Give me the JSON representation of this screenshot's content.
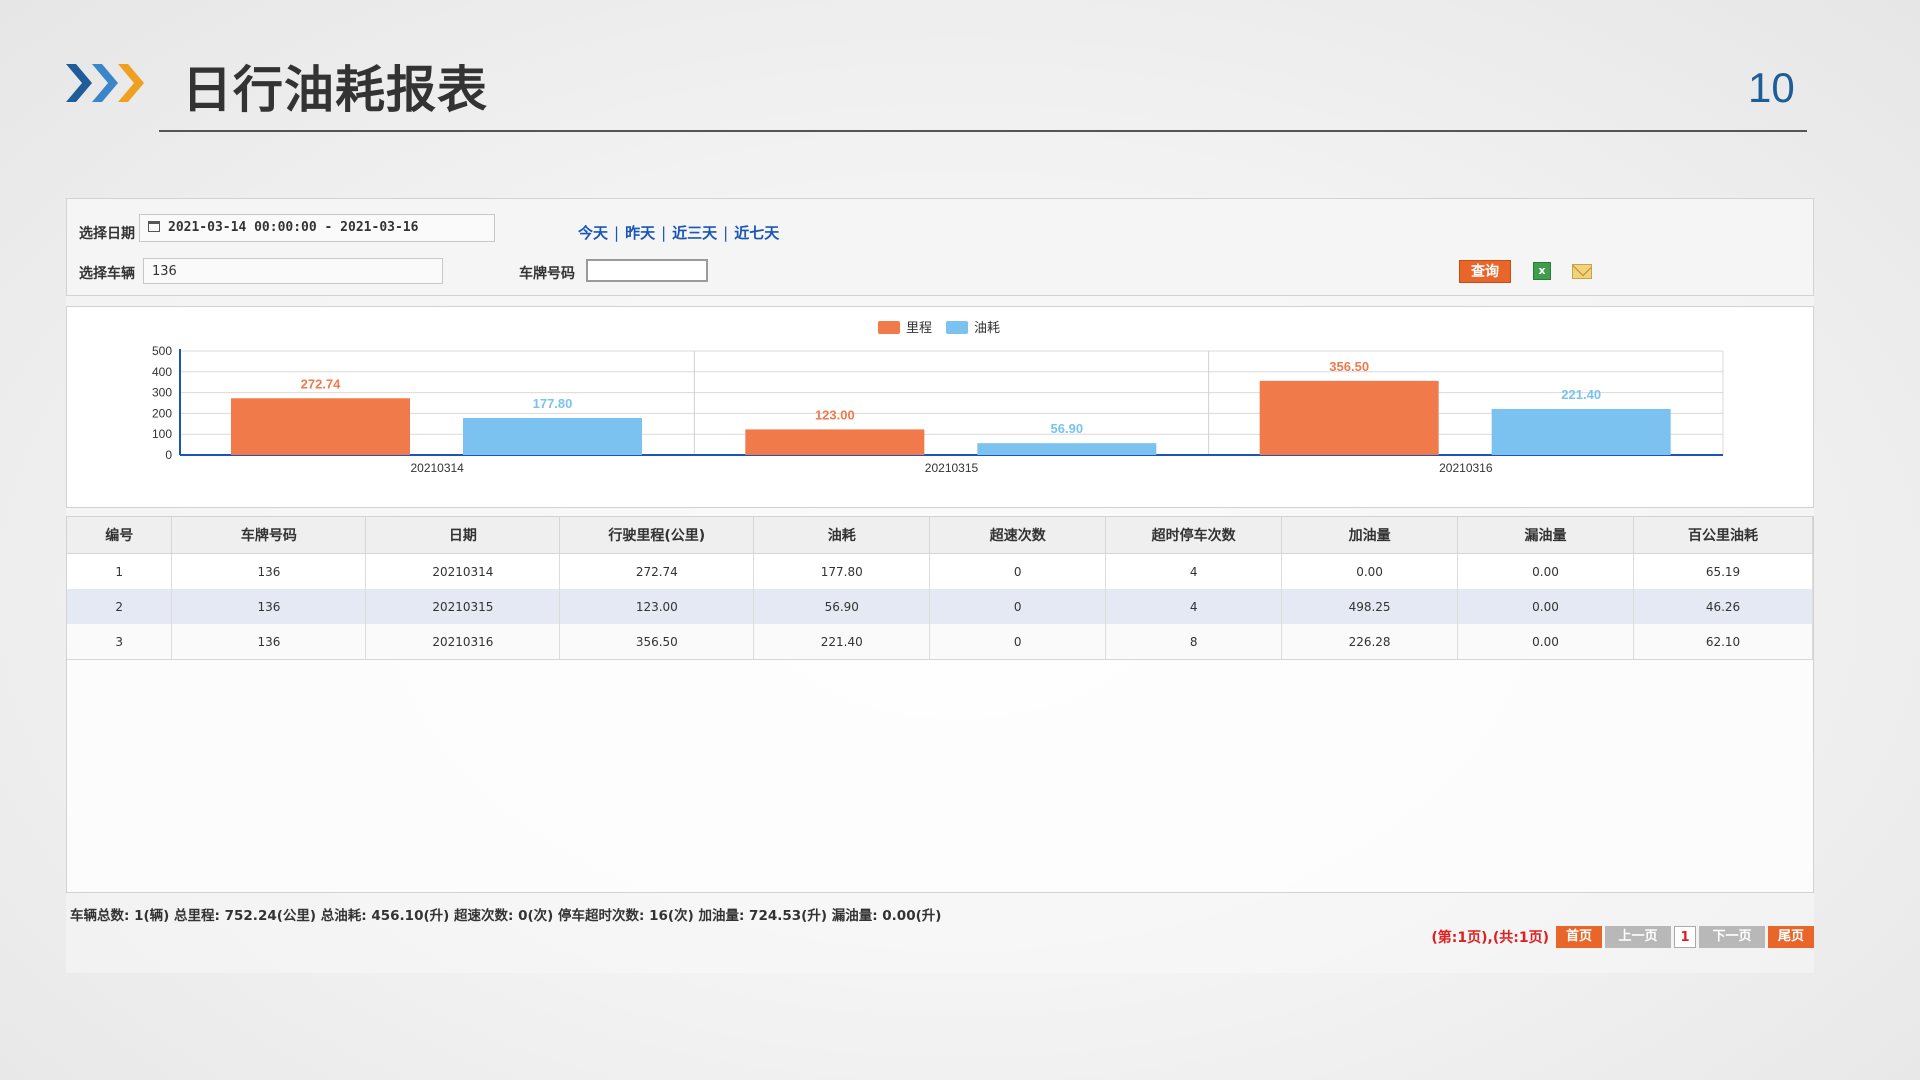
{
  "slide": {
    "title": "日行油耗报表",
    "page_number": "10"
  },
  "filter": {
    "date_label": "选择日期",
    "date_value": "2021-03-14 00:00:00 - 2021-03-16",
    "quick_ranges": [
      "今天",
      "昨天",
      "近三天",
      "近七天"
    ],
    "vehicle_label": "选择车辆",
    "vehicle_value": "136",
    "plate_label": "车牌号码",
    "plate_value": "",
    "query_label": "查询",
    "export_icon": "excel-icon",
    "mail_icon": "envelope-icon"
  },
  "chart_data": {
    "type": "bar",
    "categories": [
      "20210314",
      "20210315",
      "20210316"
    ],
    "series": [
      {
        "name": "里程",
        "values": [
          272.74,
          123.0,
          356.5
        ],
        "labels": [
          "272.74",
          "123.00",
          "356.50"
        ],
        "color": "#f07a4a"
      },
      {
        "name": "油耗",
        "values": [
          177.8,
          56.9,
          221.4
        ],
        "labels": [
          "177.80",
          "56.90",
          "221.40"
        ],
        "color": "#7cc2f0"
      }
    ],
    "yticks": [
      0,
      100,
      200,
      300,
      400,
      500
    ],
    "ylim": [
      0,
      500
    ],
    "grid": true,
    "legend_position": "top-center"
  },
  "table": {
    "columns": [
      "编号",
      "车牌号码",
      "日期",
      "行驶里程(公里)",
      "油耗",
      "超速次数",
      "超时停车次数",
      "加油量",
      "漏油量",
      "百公里油耗"
    ],
    "rows": [
      [
        "1",
        "136",
        "20210314",
        "272.74",
        "177.80",
        "0",
        "4",
        "0.00",
        "0.00",
        "65.19"
      ],
      [
        "2",
        "136",
        "20210315",
        "123.00",
        "56.90",
        "0",
        "4",
        "498.25",
        "0.00",
        "46.26"
      ],
      [
        "3",
        "136",
        "20210316",
        "356.50",
        "221.40",
        "0",
        "8",
        "226.28",
        "0.00",
        "62.10"
      ]
    ]
  },
  "summary": "车辆总数: 1(辆) 总里程: 752.24(公里) 总油耗: 456.10(升) 超速次数: 0(次) 停车超时次数: 16(次) 加油量: 724.53(升) 漏油量: 0.00(升)",
  "pager": {
    "info": "(第:1页),(共:1页)",
    "first": "首页",
    "prev": "上一页",
    "current": "1",
    "next": "下一页",
    "last": "尾页"
  },
  "colors": {
    "accent_orange": "#e8662a",
    "chevron_blue": "#1f5d99",
    "chevron_orange": "#f0a020",
    "link_blue": "#1a56b8"
  }
}
